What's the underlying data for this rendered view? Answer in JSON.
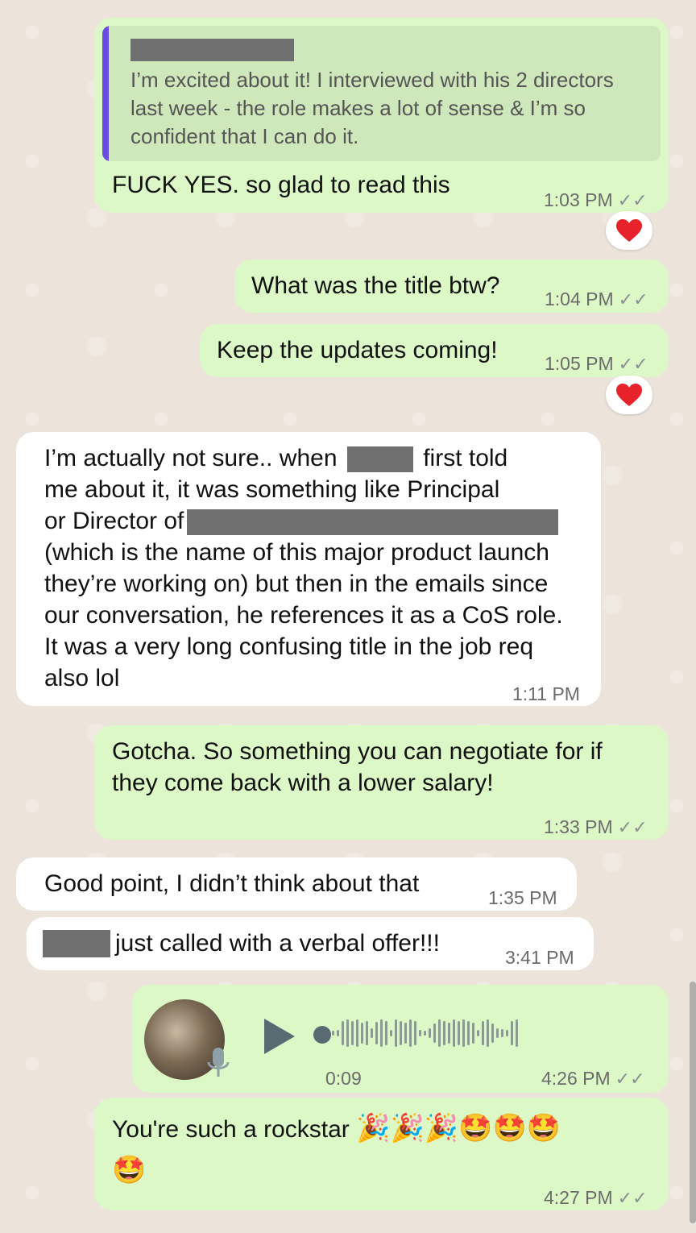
{
  "messages": {
    "m1": {
      "quote_text": "I’m excited about it! I interviewed with his 2 directors last week - the role makes a lot of sense & I’m so confident that I can do it.",
      "text": "FUCK YES. so glad to read this",
      "time": "1:03 PM"
    },
    "m2": {
      "text": "What was the title btw?",
      "time": "1:04 PM"
    },
    "m3": {
      "text": "Keep the updates coming!",
      "time": "1:05 PM"
    },
    "m4": {
      "line1_a": "I’m actually not sure.. when",
      "line1_b": "first told",
      "line2": "me about it, it was something like Principal",
      "line3": "or Director of",
      "rest": "(which is the name of this major product launch they’re working on) but then in the emails since our conversation, he references it as a CoS role. It was a very long confusing title in the job req also lol",
      "time": "1:11 PM"
    },
    "m5": {
      "text": "Gotcha. So something you can negotiate for if they come back with a lower salary!",
      "time": "1:33 PM"
    },
    "m6": {
      "text": "Good point, I didn’t think about that",
      "time": "1:35 PM"
    },
    "m7": {
      "text": "just called with a verbal offer!!!",
      "time": "3:41 PM"
    },
    "m8": {
      "duration": "0:09",
      "time": "4:26 PM"
    },
    "m9": {
      "text": "You're such a rockstar",
      "emojis": "🎉🎉🎉🤩🤩🤩",
      "emoji_line2": "🤩",
      "time": "4:27 PM"
    }
  },
  "icons": {
    "ticks": "✓✓",
    "heart": "heart-icon",
    "play": "play-icon",
    "mic": "mic-icon"
  },
  "colors": {
    "outgoing": "#dcf8c6",
    "incoming": "#ffffff",
    "quote_bar": "#6b4ce0",
    "heart": "#e8222a"
  }
}
